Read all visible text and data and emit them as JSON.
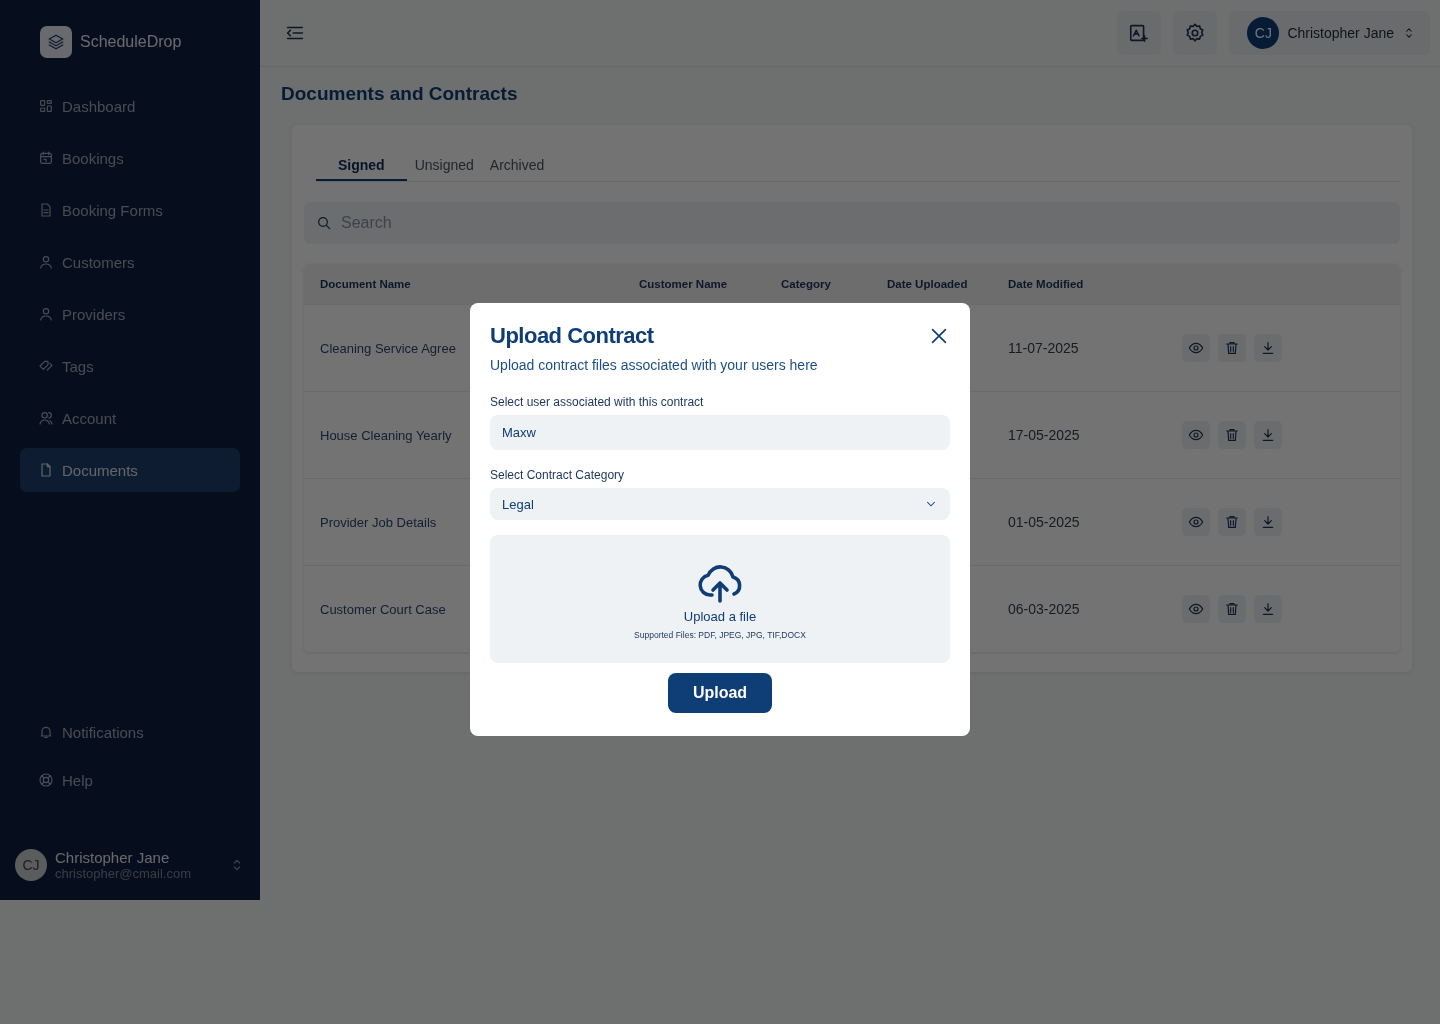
{
  "sidebar": {
    "brand": "ScheduleDrop",
    "items": [
      {
        "label": "Dashboard",
        "selected": false
      },
      {
        "label": "Bookings",
        "selected": false
      },
      {
        "label": "Booking Forms",
        "selected": false
      },
      {
        "label": "Customers",
        "selected": false
      },
      {
        "label": "Providers",
        "selected": false
      },
      {
        "label": "Tags",
        "selected": false
      },
      {
        "label": "Account",
        "selected": false
      },
      {
        "label": "Documents",
        "selected": true
      }
    ],
    "footer_items": [
      {
        "label": "Notifications"
      },
      {
        "label": "Help"
      }
    ],
    "user": {
      "initials": "CJ",
      "name": "Christopher Jane",
      "email": "christopher@cmail.com"
    }
  },
  "topbar": {
    "user": {
      "initials": "CJ",
      "name": "Christopher Jane"
    }
  },
  "page_title": "Documents and Contracts",
  "tabs": [
    {
      "label": "Signed",
      "selected": true
    },
    {
      "label": "Unsigned",
      "selected": false
    },
    {
      "label": "Archived",
      "selected": false
    }
  ],
  "search": {
    "placeholder": "Search"
  },
  "table": {
    "columns": [
      "Document Name",
      "Customer Name",
      "Category",
      "Date Uploaded",
      "Date Modified"
    ],
    "rows": [
      {
        "document_name": "Cleaning Service Agree",
        "date_modified": "11-07-2025"
      },
      {
        "document_name": "House Cleaning Yearly",
        "date_modified": "17-05-2025"
      },
      {
        "document_name": "Provider Job Details",
        "date_modified": "01-05-2025"
      },
      {
        "document_name": "Customer Court Case",
        "date_modified": "06-03-2025"
      }
    ]
  },
  "modal": {
    "title": "Upload Contract",
    "subtitle": "Upload contract files associated with your users here",
    "user_field": {
      "label": "Select user associated with this contract",
      "value": "Maxw"
    },
    "category_field": {
      "label": "Select Contract Category",
      "value": "Legal"
    },
    "dropzone": {
      "title": "Upload a file",
      "note": "Supported Files: PDF, JPEG, JPG, TIF,DOCX"
    },
    "button": "Upload"
  }
}
